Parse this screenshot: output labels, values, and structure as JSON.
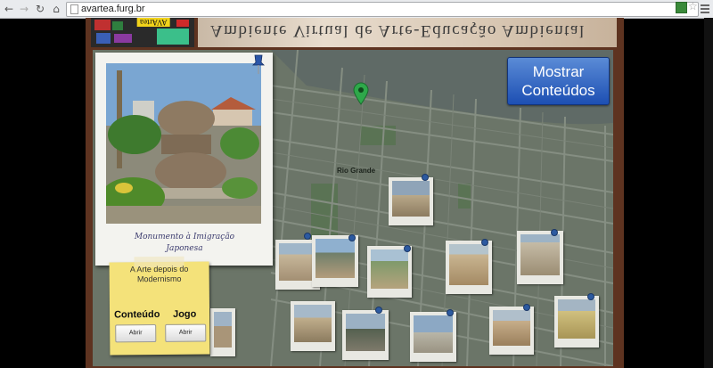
{
  "browser": {
    "url": "avartea.furg.br",
    "back_icon": "arrow-left-icon",
    "forward_icon": "arrow-right-icon",
    "reload_icon": "reload-icon",
    "home_icon": "home-icon"
  },
  "header": {
    "logo_text": "AVArtea",
    "title": "Ambiente Virtual de Arte-Educação Ambiental"
  },
  "map": {
    "city_label": "Rio Grande"
  },
  "featured": {
    "caption_line1": "Monumento à Imigração",
    "caption_line2": "Japonesa"
  },
  "show_button": {
    "line1": "Mostrar",
    "line2": "Conteúdos"
  },
  "note": {
    "title_line1": "A Arte depois do",
    "title_line2": "Modernismo",
    "content_label": "Conteúdo",
    "game_label": "Jogo",
    "open_content": "Abrir",
    "open_game": "Abrir"
  },
  "colors": {
    "frame": "#5e3320",
    "button_blue": "#1d4fb3",
    "note_yellow": "#f4e27a"
  }
}
